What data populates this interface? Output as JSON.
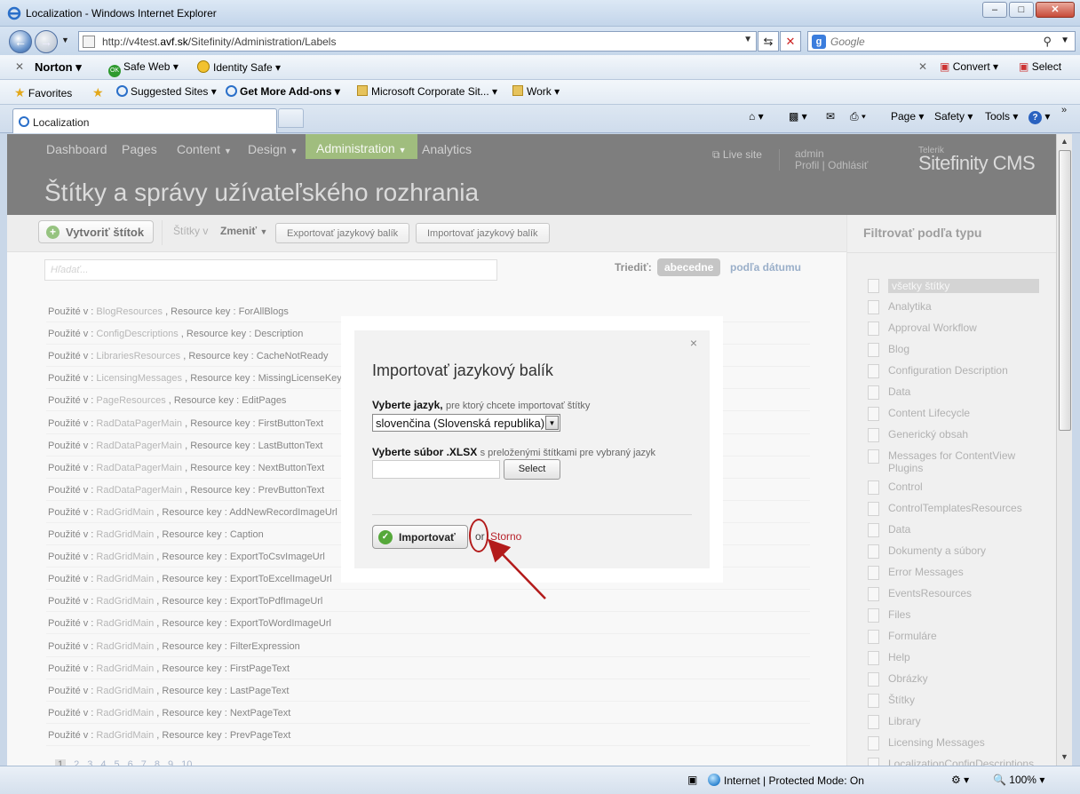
{
  "window": {
    "title": "Localization - Windows Internet Explorer"
  },
  "address": {
    "url_prefix": "http://v4test.",
    "url_host": "avf.sk",
    "url_path": "/Sitefinity/Administration/Labels"
  },
  "search": {
    "placeholder": "Google"
  },
  "norton_bar": {
    "brand": "Norton",
    "safe_web": "Safe Web",
    "identity_safe": "Identity Safe",
    "convert": "Convert",
    "select": "Select"
  },
  "favorites_bar": {
    "favorites": "Favorites",
    "suggested": "Suggested Sites",
    "addons": "Get More Add-ons",
    "corp": "Microsoft Corporate Sit...",
    "work": "Work"
  },
  "tab": {
    "label": "Localization"
  },
  "command_bar": {
    "page": "Page",
    "safety": "Safety",
    "tools": "Tools"
  },
  "cms": {
    "nav": [
      "Dashboard",
      "Pages",
      "Content",
      "Design",
      "Administration",
      "Analytics"
    ],
    "live_site": "Live site",
    "user": "admin",
    "profile": "Profil",
    "logout": "Odhlásiť",
    "logo_small": "Telerik",
    "logo_big": "Sitefinity CMS",
    "page_title": "Štítky a správy užívateľského rozhrania"
  },
  "actionbar": {
    "create": "Vytvoriť štítok",
    "labels_in": "Štítky v",
    "change": "Zmeniť",
    "export": "Exportovať jazykový balík",
    "import": "Importovať jazykový balík"
  },
  "list": {
    "search_placeholder": "Hľadať...",
    "sort_label": "Triediť:",
    "sort_active": "abecedne",
    "sort_other": "podľa dátumu",
    "rows": [
      {
        "prefix": "Použité v : ",
        "res": "BlogResources",
        "key": " , Resource key : ForAllBlogs"
      },
      {
        "prefix": "Použité v : ",
        "res": "ConfigDescriptions",
        "key": " , Resource key : Description"
      },
      {
        "prefix": "Použité v : ",
        "res": "LibrariesResources",
        "key": " , Resource key : CacheNotReady"
      },
      {
        "prefix": "Použité v : ",
        "res": "LicensingMessages",
        "key": " , Resource key : MissingLicenseKey"
      },
      {
        "prefix": "Použité v : ",
        "res": "PageResources",
        "key": " , Resource key : EditPages"
      },
      {
        "prefix": "Použité v : ",
        "res": "RadDataPagerMain",
        "key": " , Resource key : FirstButtonText"
      },
      {
        "prefix": "Použité v : ",
        "res": "RadDataPagerMain",
        "key": " , Resource key : LastButtonText"
      },
      {
        "prefix": "Použité v : ",
        "res": "RadDataPagerMain",
        "key": " , Resource key : NextButtonText"
      },
      {
        "prefix": "Použité v : ",
        "res": "RadDataPagerMain",
        "key": " , Resource key : PrevButtonText"
      },
      {
        "prefix": "Použité v : ",
        "res": "RadGridMain",
        "key": " , Resource key : AddNewRecordImageUrl"
      },
      {
        "prefix": "Použité v : ",
        "res": "RadGridMain",
        "key": " , Resource key : Caption"
      },
      {
        "prefix": "Použité v : ",
        "res": "RadGridMain",
        "key": " , Resource key : ExportToCsvImageUrl"
      },
      {
        "prefix": "Použité v : ",
        "res": "RadGridMain",
        "key": " , Resource key : ExportToExcelImageUrl"
      },
      {
        "prefix": "Použité v : ",
        "res": "RadGridMain",
        "key": " , Resource key : ExportToPdfImageUrl"
      },
      {
        "prefix": "Použité v : ",
        "res": "RadGridMain",
        "key": " , Resource key : ExportToWordImageUrl"
      },
      {
        "prefix": "Použité v : ",
        "res": "RadGridMain",
        "key": " , Resource key : FilterExpression"
      },
      {
        "prefix": "Použité v : ",
        "res": "RadGridMain",
        "key": " , Resource key : FirstPageText"
      },
      {
        "prefix": "Použité v : ",
        "res": "RadGridMain",
        "key": " , Resource key : LastPageText"
      },
      {
        "prefix": "Použité v : ",
        "res": "RadGridMain",
        "key": " , Resource key : NextPageText"
      },
      {
        "prefix": "Použité v : ",
        "res": "RadGridMain",
        "key": " , Resource key : PrevPageText"
      }
    ],
    "pages": [
      "1",
      "2",
      "3",
      "4",
      "5",
      "6",
      "7",
      "8",
      "9",
      "10"
    ]
  },
  "sidebar": {
    "title": "Filtrovať podľa typu",
    "items": [
      "všetky štítky",
      "Analytika",
      "Approval Workflow",
      "Blog",
      "Configuration Description",
      "Data",
      "Content Lifecycle",
      "Generický obsah",
      "Messages for ContentView Plugins",
      "Control",
      "ControlTemplatesResources",
      "Data",
      "Dokumenty a súbory",
      "Error Messages",
      "EventsResources",
      "Files",
      "Formuláre",
      "Help",
      "Obrázky",
      "Štítky",
      "Library",
      "Licensing Messages",
      "LocalizationConfigDescriptions"
    ]
  },
  "dialog": {
    "title": "Importovať jazykový balík",
    "lang_label": "Vyberte jazyk,",
    "lang_hint": "pre ktorý chcete importovať štítky",
    "lang_value": "slovenčina (Slovenská republika)",
    "file_label": "Vyberte súbor .XLSX",
    "file_hint": "s preloženými štítkami pre vybraný jazyk",
    "select_btn": "Select",
    "import_btn": "Importovať",
    "or": "or",
    "cancel": "Storno"
  },
  "status": {
    "zone": "Internet | Protected Mode: On",
    "zoom": "100%"
  },
  "colors": {
    "accent_green": "#6e9a3a",
    "annotation_red": "#b31b1b",
    "cancel_red": "#b8232c"
  }
}
